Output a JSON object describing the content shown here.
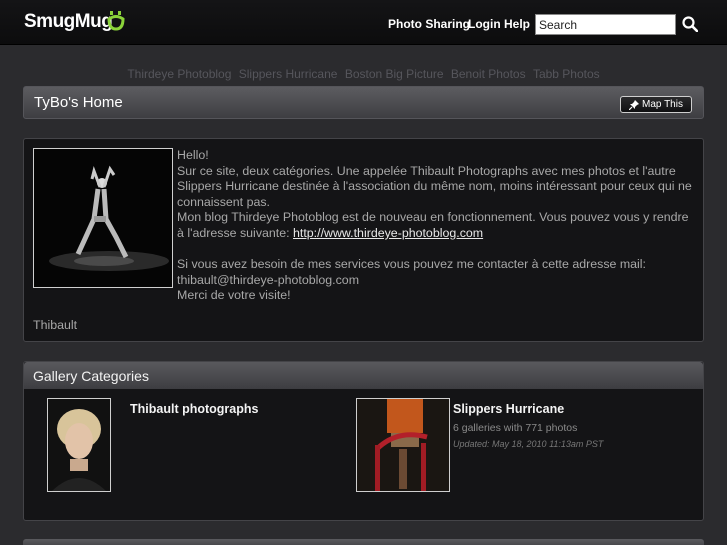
{
  "header": {
    "logo_text": "SmugMug",
    "nav": [
      "Photo Sharing",
      "Login",
      "Help"
    ],
    "search_placeholder": "Search"
  },
  "links": [
    "Thirdeye Photoblog",
    "Slippers Hurricane",
    "Boston Big Picture",
    "Benoit Photos",
    "Tabb Photos"
  ],
  "home": {
    "title": "TyBo's Home",
    "map_button": "Map This"
  },
  "bio": {
    "lines": [
      "Hello!",
      "Sur ce site, deux catégories. Une appelée Thibault Photographs avec mes photos et l'autre Slippers Hurricane destinée à l'association du même nom, moins intéressant pour ceux qui ne connaissent pas.",
      "Mon blog Thirdeye Photoblog est de nouveau en fonctionnement. Vous pouvez vous y rendre à l'adresse suivante: "
    ],
    "link": "http://www.thirdeye-photoblog.com",
    "lines2": [
      "Si vous avez besoin de mes services vous pouvez me contacter à cette adresse mail: thibault@thirdeye-photoblog.com",
      "Merci de votre visite!"
    ],
    "signature": "Thibault"
  },
  "gallery": {
    "title": "Gallery Categories",
    "categories": [
      {
        "name": "Thibault photographs"
      },
      {
        "name": "Slippers Hurricane",
        "meta": "6 galleries with 771 photos",
        "updated": "Updated: May 18, 2010 11:13am PST"
      }
    ]
  },
  "colors": {
    "accent": "#8bd33a",
    "background": "#2b2b2e",
    "panel": "#141416"
  }
}
